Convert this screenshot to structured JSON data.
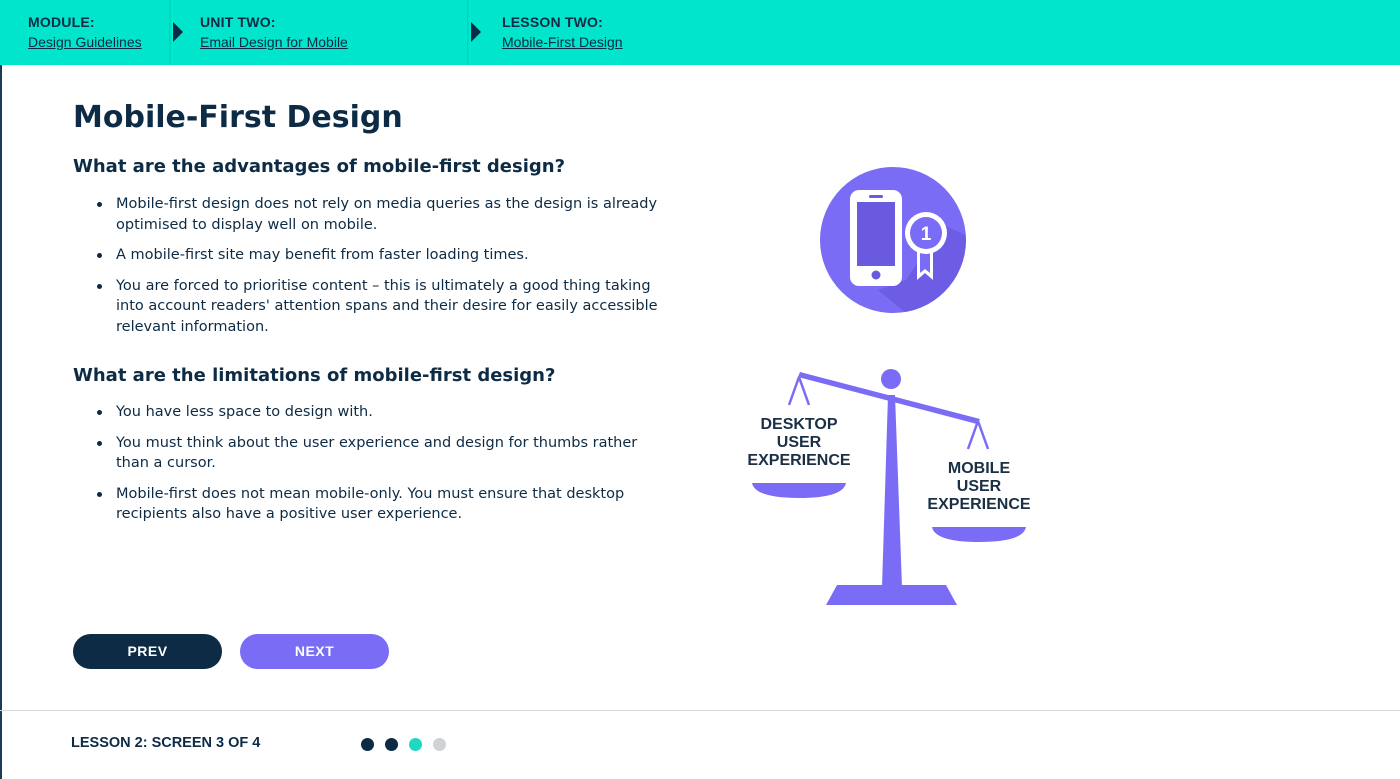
{
  "breadcrumbs": [
    {
      "label": "MODULE:",
      "link": "Design Guidelines"
    },
    {
      "label": "UNIT TWO:",
      "link": "Email Design for Mobile"
    },
    {
      "label": "LESSON TWO:",
      "link": "Mobile-First Design"
    }
  ],
  "page": {
    "title": "Mobile-First Design"
  },
  "sections": [
    {
      "heading": "What are the advantages of mobile-first design?",
      "bullets": [
        "Mobile-first design does not rely on media queries as the design is already optimised to display well on mobile.",
        "A mobile-first site may benefit from faster loading times.",
        "You are forced to prioritise content – this is ultimately a good thing taking into account readers' attention spans and their desire for easily accessible relevant information."
      ]
    },
    {
      "heading": "What are the limitations of mobile-first design?",
      "bullets": [
        "You have less space to design with.",
        "You must think about the user experience and design for thumbs rather than a cursor.",
        "Mobile-first does not mean mobile-only. You must ensure that desktop recipients also have a positive user experience."
      ]
    }
  ],
  "illustrations": {
    "phone_badge_number": "1",
    "scale_left_label": "DESKTOP\nUSER\nEXPERIENCE",
    "scale_right_label": "MOBILE\nUSER\nEXPERIENCE"
  },
  "nav": {
    "prev_label": "PREV",
    "next_label": "NEXT"
  },
  "footer": {
    "progress_label": "LESSON 2: SCREEN 3 OF 4",
    "total_screens": 4,
    "current_screen": 3
  },
  "colors": {
    "header_bg": "#00e5cc",
    "navy": "#0d2b45",
    "purple": "#7b6cf6",
    "dot_done": "#0d2b45",
    "dot_current": "#1fd8c4",
    "dot_todo": "#d0d3d6"
  },
  "icons": [
    "smartphone-award-icon",
    "balance-scale-icon"
  ]
}
